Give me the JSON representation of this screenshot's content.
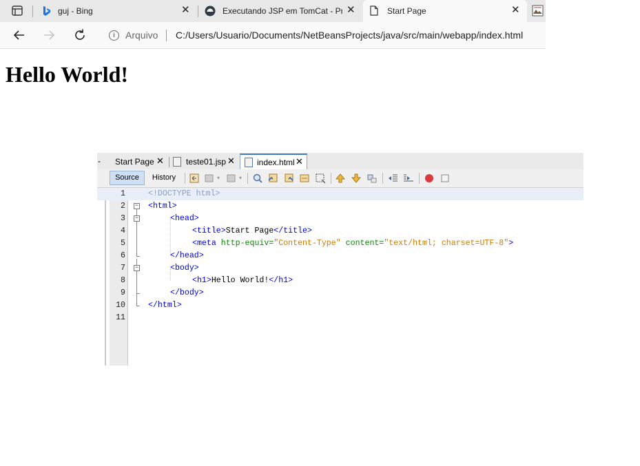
{
  "browser": {
    "tabs": [
      {
        "title": "guj - Bing",
        "icon": "bing-icon"
      },
      {
        "title": "Executando JSP em TomCat - Pro",
        "icon": "guj-icon"
      },
      {
        "title": "Start Page",
        "icon": "page-icon",
        "active": true
      }
    ],
    "close_glyph": "✕",
    "address": {
      "scheme_label": "Arquivo",
      "url": "C:/Users/Usuario/Documents/NetBeansProjects/java/src/main/webapp/index.html"
    }
  },
  "page": {
    "heading": "Hello World!"
  },
  "ide": {
    "tabs": [
      {
        "label": "Start Page"
      },
      {
        "label": "teste01.jsp"
      },
      {
        "label": "index.html",
        "active": true
      }
    ],
    "left_fragment": "-",
    "close_glyph": "✕",
    "toolbar": {
      "source_label": "Source",
      "history_label": "History"
    },
    "line_numbers": [
      "1",
      "2",
      "3",
      "4",
      "5",
      "6",
      "7",
      "8",
      "9",
      "10",
      "11"
    ],
    "code": {
      "l1": "<!DOCTYPE html>",
      "l2_open": "<html>",
      "l3_open": "<head>",
      "l4_open": "<title>",
      "l4_text": "Start Page",
      "l4_close": "</title>",
      "l5_open": "<meta ",
      "l5_attr1": "http-equiv=",
      "l5_val1": "\"Content-Type\"",
      "l5_attr2": "content=",
      "l5_val2": "\"text/html; charset=UTF-8\"",
      "l5_end": ">",
      "l6": "</head>",
      "l7": "<body>",
      "l8_open": "<h1>",
      "l8_text": "Hello World!",
      "l8_close": "</h1>",
      "l9": "</body>",
      "l10": "</html>"
    }
  },
  "colors": {
    "tag": "#0000e6",
    "attribute": "#098a00",
    "value": "#ce7b00",
    "doctype": "#8aa0c0",
    "bing_blue": "#1a73e8",
    "stop_red": "#d93a3a"
  }
}
